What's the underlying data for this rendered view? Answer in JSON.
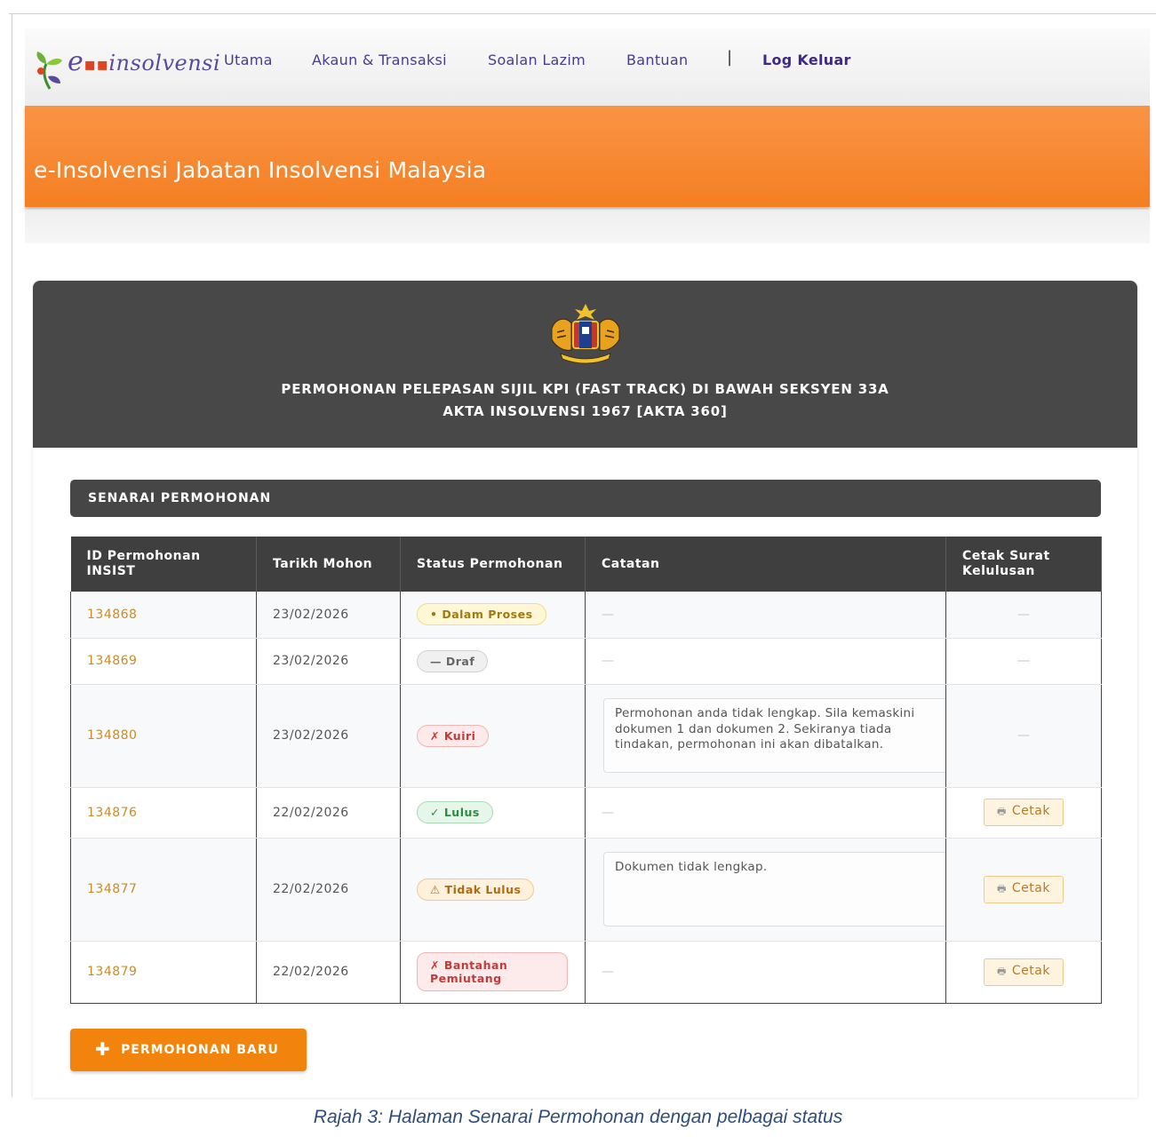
{
  "nav": {
    "logo_text_e": "e",
    "logo_text_rest": "insolvensi",
    "items": [
      "Utama",
      "Akaun & Transaksi",
      "Soalan Lazim",
      "Bantuan"
    ],
    "separator": "|",
    "logout": "Log Keluar"
  },
  "banner": {
    "title": "e-Insolvensi Jabatan Insolvensi Malaysia"
  },
  "card": {
    "title_line1": "PERMOHONAN PELEPASAN SIJIL KPI (FAST TRACK) DI BAWAH SEKSYEN 33A",
    "title_line2": "AKTA INSOLVENSI 1967 [AKTA 360]",
    "section_title": "SENARAI PERMOHONAN"
  },
  "table": {
    "headers": {
      "id": "ID Permohonan INSIST",
      "date": "Tarikh Mohon",
      "status": "Status Permohonan",
      "note": "Catatan",
      "print": "Cetak Surat Kelulusan"
    },
    "dash": "—",
    "print_label": "Cetak",
    "rows": [
      {
        "id": "134868",
        "date": "23/02/2026",
        "status": "• Dalam Proses",
        "note": "",
        "printable": false
      },
      {
        "id": "134869",
        "date": "23/02/2026",
        "status": "— Draf",
        "note": "",
        "printable": false
      },
      {
        "id": "134880",
        "date": "23/02/2026",
        "status": "✗ Kuiri",
        "note": "Permohonan anda tidak lengkap. Sila kemaskini dokumen 1 dan dokumen 2. Sekiranya tiada tindakan, permohonan ini akan dibatalkan.",
        "printable": false
      },
      {
        "id": "134876",
        "date": "22/02/2026",
        "status": "✓ Lulus",
        "note": "",
        "printable": true
      },
      {
        "id": "134877",
        "date": "22/02/2026",
        "status": "⚠ Tidak Lulus",
        "note": "Dokumen tidak lengkap.",
        "printable": true
      },
      {
        "id": "134879",
        "date": "22/02/2026",
        "status": "✗ Bantahan Pemiutang",
        "note": "",
        "printable": true
      }
    ]
  },
  "new_button": {
    "icon": "plus-icon",
    "label": "PERMOHONAN BARU"
  },
  "caption": "Rajah 3: Halaman Senarai Permohonan dengan pelbagai status",
  "colors": {
    "accent_orange": "#f57f22",
    "dark_header": "#484848",
    "nav_text": "#4b3b8f"
  }
}
